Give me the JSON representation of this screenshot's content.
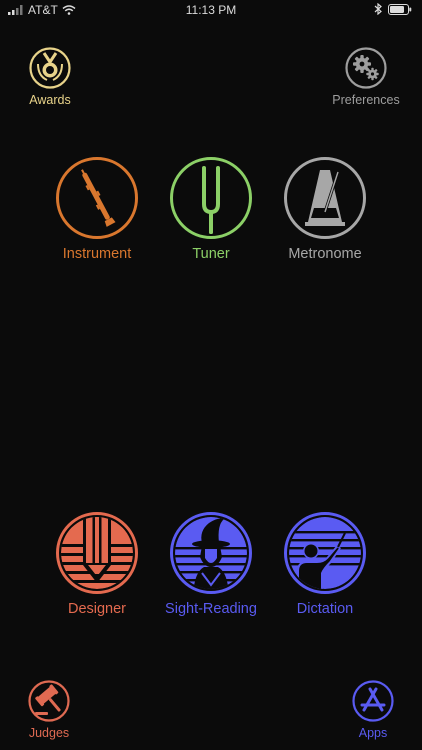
{
  "status": {
    "carrier": "AT&T",
    "time": "11:13 PM"
  },
  "colors": {
    "instrument": "#d9772e",
    "tuner": "#8cd067",
    "metronome": "#a7a7a7",
    "designer": "#e46a4f",
    "blue": "#5a5bf2",
    "gold": "#e8d38a"
  },
  "corners": {
    "awards": {
      "label": "Awards",
      "icon": "medal-icon"
    },
    "preferences": {
      "label": "Preferences",
      "icon": "gears-icon"
    },
    "judges": {
      "label": "Judges",
      "icon": "gavel-icon"
    },
    "apps": {
      "label": "Apps",
      "icon": "app-store-icon"
    }
  },
  "tools": [
    {
      "label": "Instrument",
      "icon": "oboe-icon"
    },
    {
      "label": "Tuner",
      "icon": "tuning-fork-icon"
    },
    {
      "label": "Metronome",
      "icon": "metronome-icon"
    }
  ],
  "modes": [
    {
      "label": "Designer",
      "icon": "pencil-staff-icon"
    },
    {
      "label": "Sight-Reading",
      "icon": "wizard-icon"
    },
    {
      "label": "Dictation",
      "icon": "conductor-icon"
    }
  ]
}
